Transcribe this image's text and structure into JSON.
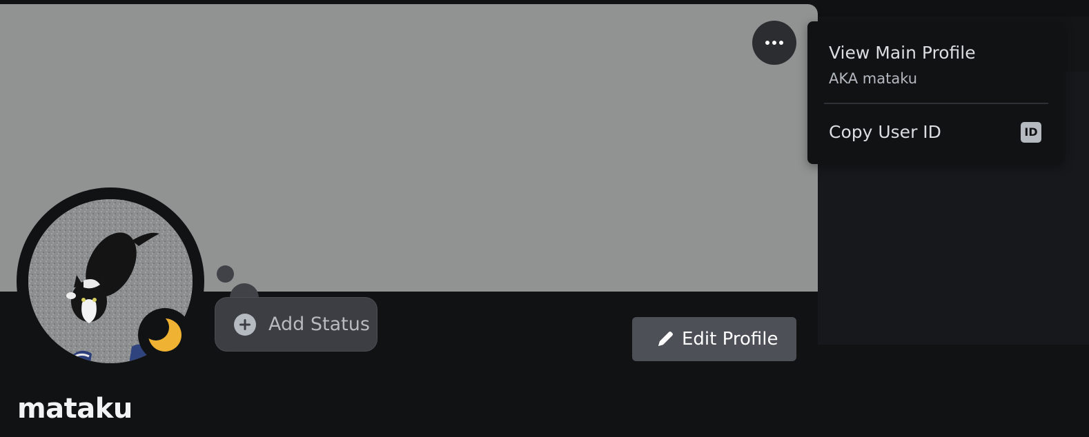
{
  "colors": {
    "banner": "#909392",
    "background": "#111214",
    "status_idle": "#f0b232",
    "button_secondary": "#4e5058",
    "menu_background": "#111214"
  },
  "profile": {
    "username": "mataku",
    "status_indicator": "idle",
    "more_button_icon": "more-horizontal-icon"
  },
  "status_bubble": {
    "label": "Add Status",
    "icon": "plus-circle-icon"
  },
  "edit_profile": {
    "label": "Edit Profile",
    "icon": "pencil-icon"
  },
  "context_menu": {
    "items": [
      {
        "label": "View Main Profile",
        "subtitle": "AKA mataku"
      },
      {
        "label": "Copy User ID",
        "badge": "ID"
      }
    ]
  }
}
